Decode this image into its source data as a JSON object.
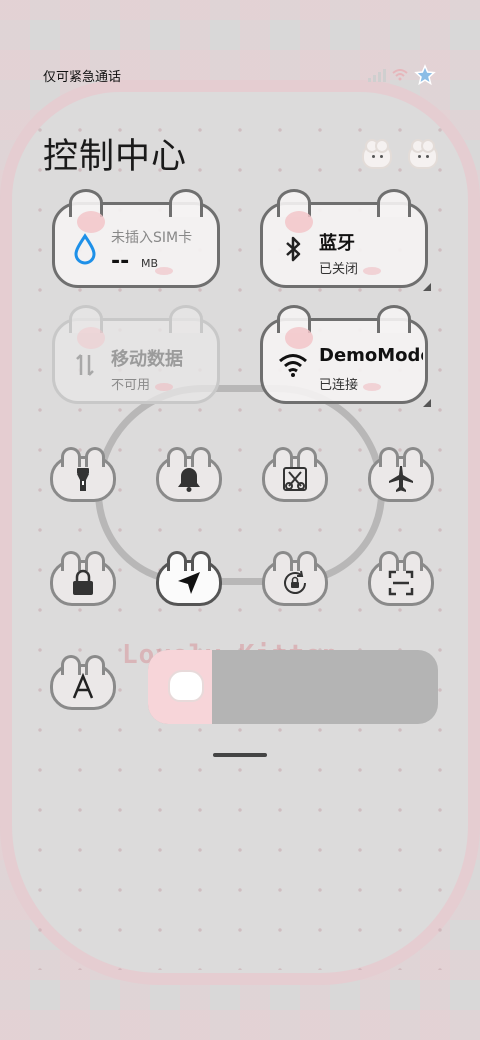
{
  "status_bar": {
    "carrier_text": "仅可紧急通话",
    "icons": [
      "signal-icon",
      "wifi-icon",
      "star-icon"
    ]
  },
  "header": {
    "title": "控制中心",
    "icons": [
      "cat-theme-icon",
      "cat-bunny-icon"
    ]
  },
  "tiles": {
    "data_usage": {
      "label": "未插入SIM卡",
      "value": "--",
      "unit": "MB",
      "icon": "water-drop-icon",
      "active": false
    },
    "bluetooth": {
      "label": "蓝牙",
      "status": "已关闭",
      "icon": "bluetooth-icon",
      "active": true
    },
    "mobile_data": {
      "label": "移动数据",
      "status": "不可用",
      "icon": "data-arrows-icon",
      "active": false
    },
    "wifi": {
      "label": "DemoMode",
      "status": "已连接",
      "icon": "wifi-icon",
      "active": true
    }
  },
  "toggles": [
    {
      "name": "flashlight",
      "icon": "flashlight-icon",
      "active": false
    },
    {
      "name": "mute",
      "icon": "bell-icon",
      "active": false
    },
    {
      "name": "screenshot",
      "icon": "scissors-icon",
      "active": false
    },
    {
      "name": "airplane-mode",
      "icon": "airplane-icon",
      "active": false
    },
    {
      "name": "lock-screen",
      "icon": "lock-icon",
      "active": false
    },
    {
      "name": "location",
      "icon": "location-arrow-icon",
      "active": true
    },
    {
      "name": "rotation-lock",
      "icon": "rotate-lock-icon",
      "active": false
    },
    {
      "name": "scan",
      "icon": "scan-icon",
      "active": false
    },
    {
      "name": "font-size",
      "icon": "letter-a-icon",
      "active": false
    }
  ],
  "brightness": {
    "level": 0.22,
    "icon": "cat-thumb-icon"
  },
  "colors": {
    "tile_active_bg": "#f5f3f3",
    "slider_fill": "#f7d5d9",
    "slider_track": "#b4b4b4",
    "accent_pink": "#f2c5c9",
    "water_icon": "#1e90e8"
  },
  "background_text": "Lovely Kitten"
}
